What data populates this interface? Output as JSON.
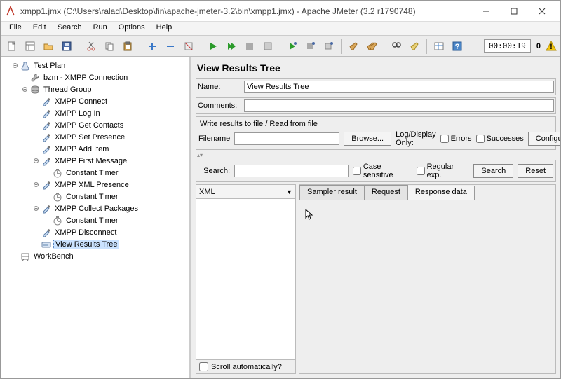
{
  "window": {
    "title": "xmpp1.jmx (C:\\Users\\ralad\\Desktop\\fin\\apache-jmeter-3.2\\bin\\xmpp1.jmx) - Apache JMeter (3.2 r1790748)"
  },
  "menus": [
    "File",
    "Edit",
    "Search",
    "Run",
    "Options",
    "Help"
  ],
  "toolbar": {
    "time": "00:00:19",
    "counter": "0"
  },
  "tree": {
    "items": [
      {
        "id": "test-plan",
        "label": "Test Plan",
        "indent": 1,
        "toggle": "open",
        "icon": "flask"
      },
      {
        "id": "bzm",
        "label": "bzm - XMPP Connection",
        "indent": 2,
        "toggle": "none",
        "icon": "wrench"
      },
      {
        "id": "thread-group",
        "label": "Thread Group",
        "indent": 2,
        "toggle": "open",
        "icon": "spool"
      },
      {
        "id": "connect",
        "label": "XMPP Connect",
        "indent": 3,
        "toggle": "none",
        "icon": "dropper"
      },
      {
        "id": "login",
        "label": "XMPP Log In",
        "indent": 3,
        "toggle": "none",
        "icon": "dropper"
      },
      {
        "id": "contacts",
        "label": "XMPP Get Contacts",
        "indent": 3,
        "toggle": "none",
        "icon": "dropper"
      },
      {
        "id": "presence",
        "label": "XMPP Set Presence",
        "indent": 3,
        "toggle": "none",
        "icon": "dropper"
      },
      {
        "id": "additem",
        "label": "XMPP Add Item",
        "indent": 3,
        "toggle": "none",
        "icon": "dropper"
      },
      {
        "id": "firstmsg",
        "label": "XMPP First Message",
        "indent": 3,
        "toggle": "open",
        "icon": "dropper"
      },
      {
        "id": "ct1",
        "label": "Constant Timer",
        "indent": 4,
        "toggle": "none",
        "icon": "timer"
      },
      {
        "id": "xmlpres",
        "label": "XMPP XML Presence",
        "indent": 3,
        "toggle": "open",
        "icon": "dropper"
      },
      {
        "id": "ct2",
        "label": "Constant Timer",
        "indent": 4,
        "toggle": "none",
        "icon": "timer"
      },
      {
        "id": "collect",
        "label": "XMPP Collect Packages",
        "indent": 3,
        "toggle": "open",
        "icon": "dropper"
      },
      {
        "id": "ct3",
        "label": "Constant Timer",
        "indent": 4,
        "toggle": "none",
        "icon": "timer"
      },
      {
        "id": "disconnect",
        "label": "XMPP Disconnect",
        "indent": 3,
        "toggle": "none",
        "icon": "dropper"
      },
      {
        "id": "vrt",
        "label": "View Results Tree",
        "indent": 3,
        "toggle": "none",
        "icon": "pager",
        "selected": true
      },
      {
        "id": "workbench",
        "label": "WorkBench",
        "indent": 1,
        "toggle": "none",
        "icon": "workbench"
      }
    ]
  },
  "panel": {
    "title": "View Results Tree",
    "name_label": "Name:",
    "name_value": "View Results Tree",
    "comments_label": "Comments:",
    "comments_value": "",
    "write_title": "Write results to file / Read from file",
    "filename_label": "Filename",
    "filename_value": "",
    "browse": "Browse...",
    "logdisplay": "Log/Display Only:",
    "errors": "Errors",
    "successes": "Successes",
    "configure": "Configure",
    "search_label": "Search:",
    "case_sensitive": "Case sensitive",
    "regex": "Regular exp.",
    "search_btn": "Search",
    "reset_btn": "Reset",
    "combo": "XML",
    "scroll_auto": "Scroll automatically?",
    "tabs": {
      "sampler": "Sampler result",
      "request": "Request",
      "response": "Response data"
    }
  }
}
